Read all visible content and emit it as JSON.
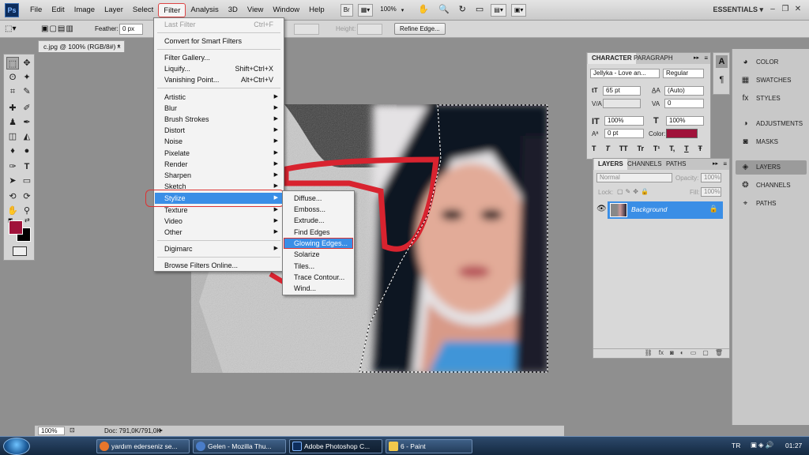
{
  "menubar": {
    "app_icon": "Ps",
    "items": [
      "File",
      "Edit",
      "Image",
      "Layer",
      "Select",
      "Filter",
      "Analysis",
      "3D",
      "View",
      "Window",
      "Help"
    ],
    "zoom": "100%",
    "workspace": "ESSENTIALS",
    "bridge_label": "Br"
  },
  "optionsbar": {
    "feather_label": "Feather:",
    "feather_value": "0 px",
    "width_label": "Width:",
    "height_label": "Height:",
    "refine_edge": "Refine Edge..."
  },
  "document": {
    "tab_title": "c.jpg @ 100% (RGB/8#) *",
    "status_zoom": "100%",
    "status_doc": "Doc: 791,0K/791,0K"
  },
  "filter_menu": {
    "last_filter": "Last Filter",
    "last_filter_shortcut": "Ctrl+F",
    "convert_smart": "Convert for Smart Filters",
    "filter_gallery": "Filter Gallery...",
    "liquify": "Liquify...",
    "liquify_shortcut": "Shift+Ctrl+X",
    "vanishing_point": "Vanishing Point...",
    "vanishing_shortcut": "Alt+Ctrl+V",
    "submenus": [
      "Artistic",
      "Blur",
      "Brush Strokes",
      "Distort",
      "Noise",
      "Pixelate",
      "Render",
      "Sharpen",
      "Sketch",
      "Stylize",
      "Texture",
      "Video",
      "Other"
    ],
    "digimarc": "Digimarc",
    "browse_online": "Browse Filters Online..."
  },
  "stylize_submenu": [
    "Diffuse...",
    "Emboss...",
    "Extrude...",
    "Find Edges",
    "Glowing Edges...",
    "Solarize",
    "Tiles...",
    "Trace Contour...",
    "Wind..."
  ],
  "character_panel": {
    "tab_character": "CHARACTER",
    "tab_paragraph": "PARAGRAPH",
    "font_family": "Jellyka - Love an...",
    "font_style": "Regular",
    "font_size": "65 pt",
    "leading": "(Auto)",
    "tracking": "0",
    "vscale": "100%",
    "hscale": "100%",
    "baseline": "0 pt",
    "color_label": "Color:",
    "text_color": "#a0123a",
    "style_buttons": [
      "T",
      "T",
      "TT",
      "Tr",
      "T¹",
      "T,",
      "T",
      "Ŧ"
    ]
  },
  "layers_panel": {
    "tabs": [
      "LAYERS",
      "CHANNELS",
      "PATHS"
    ],
    "blend_mode": "Normal",
    "opacity_label": "Opacity:",
    "opacity": "100%",
    "lock_label": "Lock:",
    "fill_label": "Fill:",
    "fill": "100%",
    "layer_name": "Background"
  },
  "dock": {
    "items": [
      "COLOR",
      "SWATCHES",
      "STYLES",
      "ADJUSTMENTS",
      "MASKS",
      "LAYERS",
      "CHANNELS",
      "PATHS"
    ]
  },
  "toolbox": {
    "foreground_color": "#a0123a",
    "background_color": "#000000"
  },
  "taskbar": {
    "tasks": [
      "yardım ederseniz se...",
      "Gelen - Mozilla Thu...",
      "Adobe Photoshop C...",
      "6 - Paint"
    ],
    "lang": "TR",
    "time": "01:27"
  }
}
